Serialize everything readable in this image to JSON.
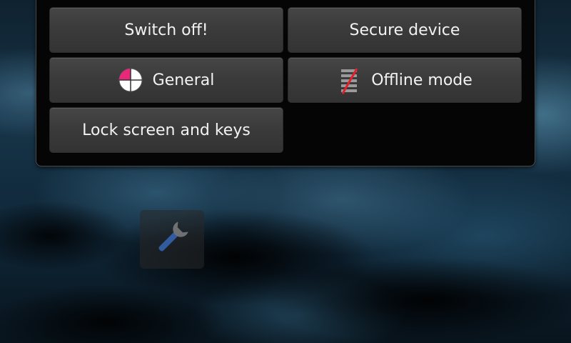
{
  "power_menu": {
    "switch_off_label": "Switch off!",
    "secure_device_label": "Secure device",
    "general_label": "General",
    "offline_mode_label": "Offline mode",
    "lock_screen_label": "Lock screen and keys",
    "general_icon": "profile-pie-icon",
    "offline_icon": "offline-mode-icon"
  },
  "desktop": {
    "applet_icon": "wrench-icon"
  },
  "colors": {
    "profile_accent": "#e8297a",
    "offline_strike": "#e0202a"
  }
}
